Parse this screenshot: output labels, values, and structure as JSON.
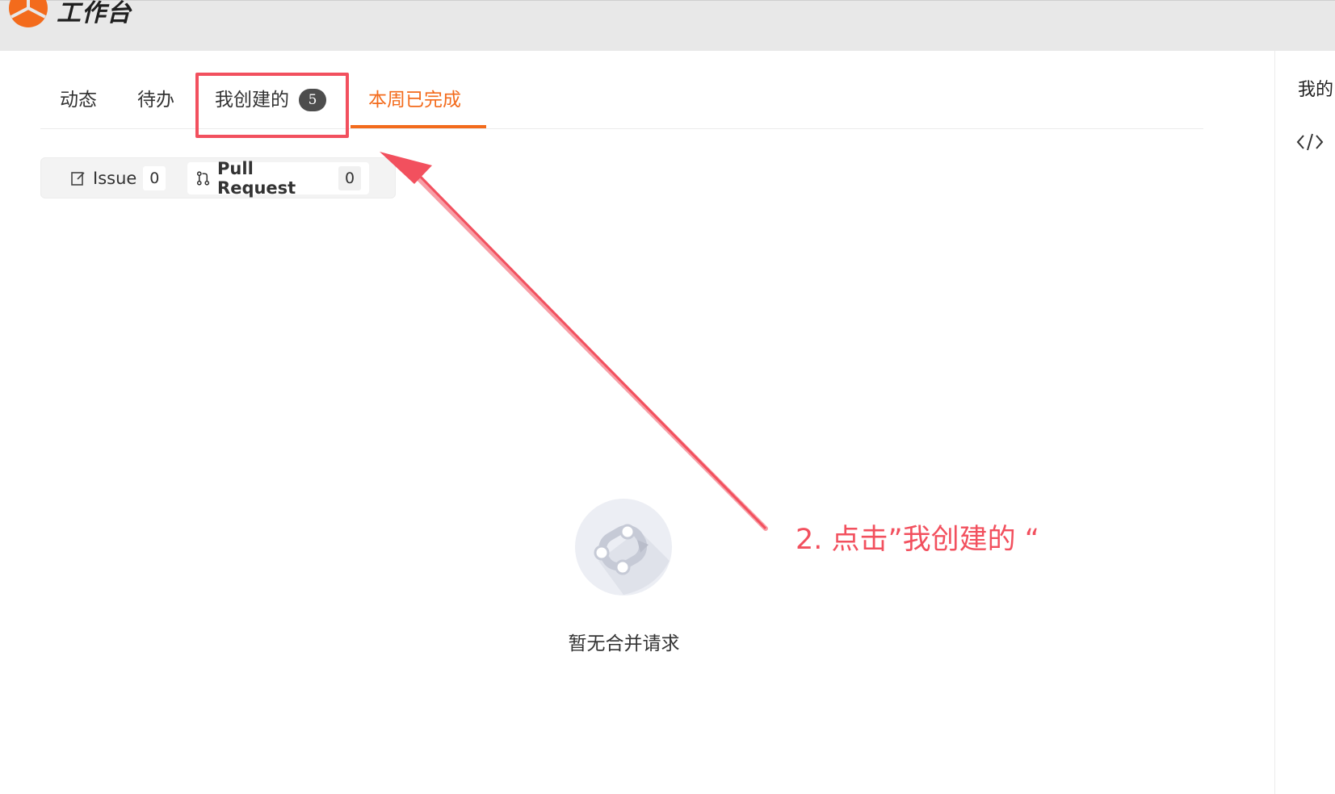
{
  "header": {
    "app_title": "工作台",
    "logo_icon": "orange-fan-logo-icon"
  },
  "tabs": [
    {
      "label": "动态"
    },
    {
      "label": "待办"
    },
    {
      "label": "我创建的",
      "badge": "5"
    },
    {
      "label": "本周已完成",
      "active": true
    }
  ],
  "filters": [
    {
      "label": "Issue",
      "count": "0",
      "icon": "edit-issue-icon"
    },
    {
      "label": "Pull Request",
      "count": "0",
      "icon": "pull-request-icon",
      "selected": true
    }
  ],
  "right_panel": {
    "title": "我的",
    "icon": "code-icon"
  },
  "empty_state": {
    "text": "暂无合并请求",
    "icon": "merge-request-illustration-icon"
  },
  "annotation": {
    "text": "2. 点击”我创建的 “",
    "color": "#f2505e"
  },
  "colors": {
    "accent": "#f36b1c",
    "annotation": "#f2505e",
    "badge": "#4d4d4d"
  }
}
